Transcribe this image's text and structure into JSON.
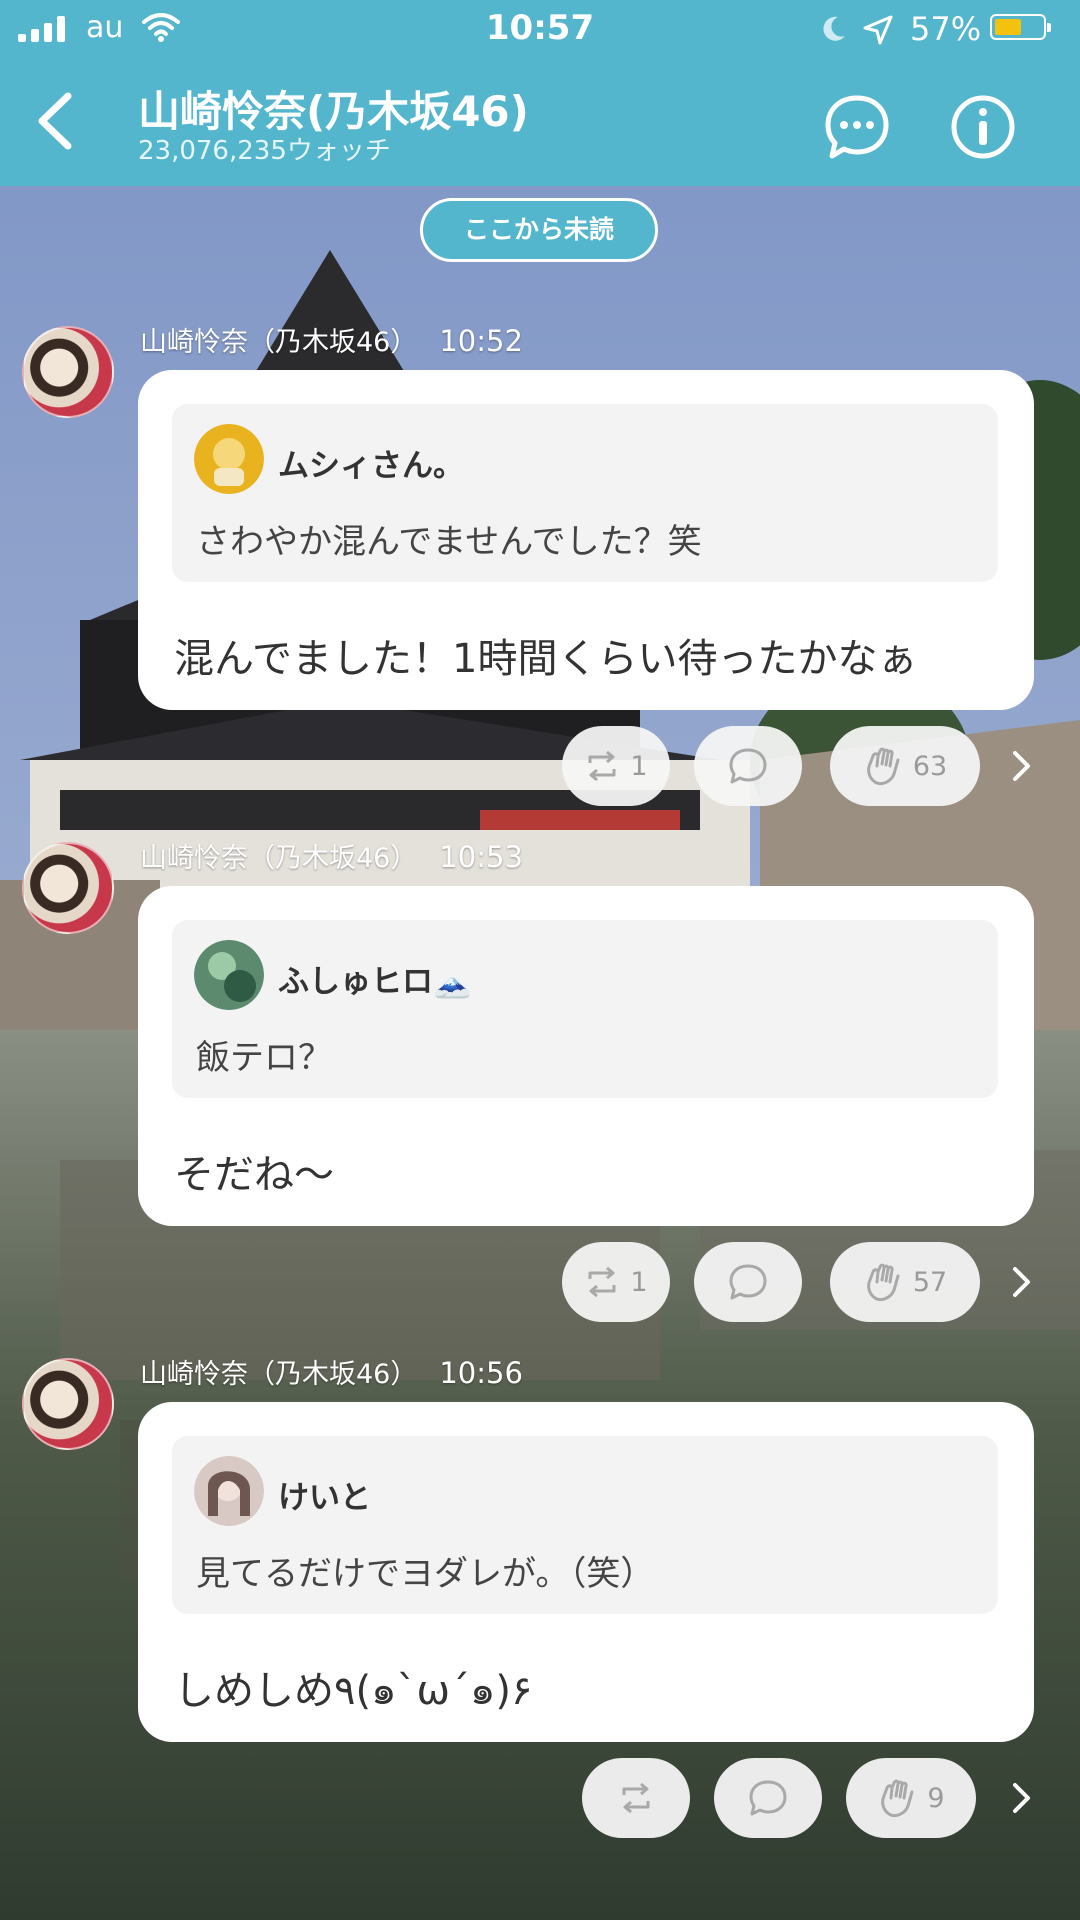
{
  "status_bar": {
    "carrier": "au",
    "time": "10:57",
    "battery_percent": "57%",
    "battery_level": 0.57,
    "icons": [
      "signal-icon",
      "wifi-icon",
      "moon-icon",
      "location-arrow-icon",
      "battery-icon"
    ]
  },
  "header": {
    "title": "山崎怜奈(乃木坂46)",
    "subtitle": "23,076,235ウォッチ",
    "background_color": "#54b6cc"
  },
  "unread_label": "ここから未読",
  "messages": [
    {
      "sender": "山崎怜奈（乃木坂46）",
      "time": "10:52",
      "quote": {
        "name": "ムシィさん。",
        "text": "さわやか混んでませんでした？笑"
      },
      "reply": "混んでました！1時間くらい待ったかなぁ",
      "repost_count": "1",
      "clap_count": "63"
    },
    {
      "sender": "山崎怜奈（乃木坂46）",
      "time": "10:53",
      "quote": {
        "name": "ふしゅヒロ🗻",
        "text": "飯テロ？"
      },
      "reply": "そだね〜",
      "repost_count": "1",
      "clap_count": "57"
    },
    {
      "sender": "山崎怜奈（乃木坂46）",
      "time": "10:56",
      "quote": {
        "name": "けいと",
        "text": "見てるだけでヨダレが。（笑）"
      },
      "reply": "しめしめ٩(๑`ω´๑)۶",
      "repost_count": "",
      "clap_count": "9"
    }
  ]
}
